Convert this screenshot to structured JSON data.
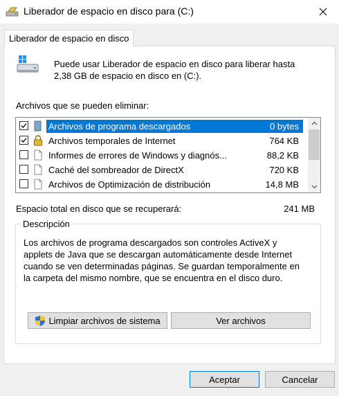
{
  "window": {
    "title": "Liberador de espacio en disco para  (C:)",
    "close_icon": "close-icon"
  },
  "tab": {
    "label": "Liberador de espacio en disco"
  },
  "intro": {
    "line1": "Puede usar Liberador de espacio en disco para liberar hasta",
    "line2": "2,38 GB de espacio en disco en  (C:).",
    "icon": "drive-cleanup-icon"
  },
  "files": {
    "label": "Archivos que se pueden eliminar:",
    "items": [
      {
        "name": "Archivos de programa descargados",
        "size": "0 bytes",
        "checked": true,
        "selected": true,
        "icon": "folder-icon"
      },
      {
        "name": "Archivos temporales de Internet",
        "size": "764 KB",
        "checked": true,
        "selected": false,
        "icon": "lock-icon"
      },
      {
        "name": "Informes de errores de Windows y diagnós...",
        "size": "88,2 KB",
        "checked": false,
        "selected": false,
        "icon": "document-icon"
      },
      {
        "name": "Caché del sombreador de DirectX",
        "size": "720 KB",
        "checked": false,
        "selected": false,
        "icon": "document-icon"
      },
      {
        "name": "Archivos de Optimización de distribución",
        "size": "14,8 MB",
        "checked": false,
        "selected": false,
        "icon": "document-icon"
      }
    ]
  },
  "total": {
    "label": "Espacio total en disco que se recuperará:",
    "value": "241 MB"
  },
  "description": {
    "title": "Descripción",
    "line1": "Los archivos de programa descargados son controles ActiveX y",
    "line2": "applets de Java que se descargan automáticamente desde Internet",
    "line3": "cuando se ven determinadas páginas. Se guardan temporalmente en",
    "line4": "la carpeta del mismo nombre, que se encuentra en el disco duro."
  },
  "buttons": {
    "clean_system": "Limpiar archivos de sistema",
    "view_files": "Ver archivos",
    "ok": "Aceptar",
    "cancel": "Cancelar"
  },
  "colors": {
    "selection": "#0078d7",
    "accent": "#0078d7"
  }
}
